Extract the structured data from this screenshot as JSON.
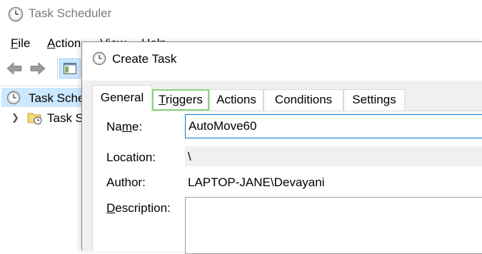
{
  "app": {
    "title": "Task Scheduler",
    "menu": {
      "file": {
        "mnemonic": "F",
        "rest": "ile"
      },
      "action": {
        "mnemonic": "A",
        "rest": "ction"
      },
      "view": {
        "mnemonic": "V",
        "rest": "iew"
      },
      "help": {
        "mnemonic": "H",
        "rest": "elp"
      }
    },
    "tree": {
      "root_label": "Task Scheduler (Local)",
      "child_label": "Task Scheduler Library"
    }
  },
  "dialog": {
    "title": "Create Task",
    "tabs": {
      "general": "General",
      "triggers": {
        "mnemonic": "T",
        "rest": "riggers"
      },
      "actions": "Actions",
      "conditions": "Conditions",
      "settings": "Settings"
    },
    "fields": {
      "name": {
        "pre": "Na",
        "mnemonic": "m",
        "post": "e:",
        "value": "AutoMove60"
      },
      "location": {
        "label": "Location:",
        "value": "\\"
      },
      "author": {
        "label": "Author:",
        "value": "LAPTOP-JANE\\Devayani"
      },
      "description": {
        "mnemonic": "D",
        "rest": "escription:"
      }
    }
  },
  "colors": {
    "selection": "#cce8ff",
    "focus_border": "#0078d7",
    "triggers_highlight": "#8ed27a"
  }
}
